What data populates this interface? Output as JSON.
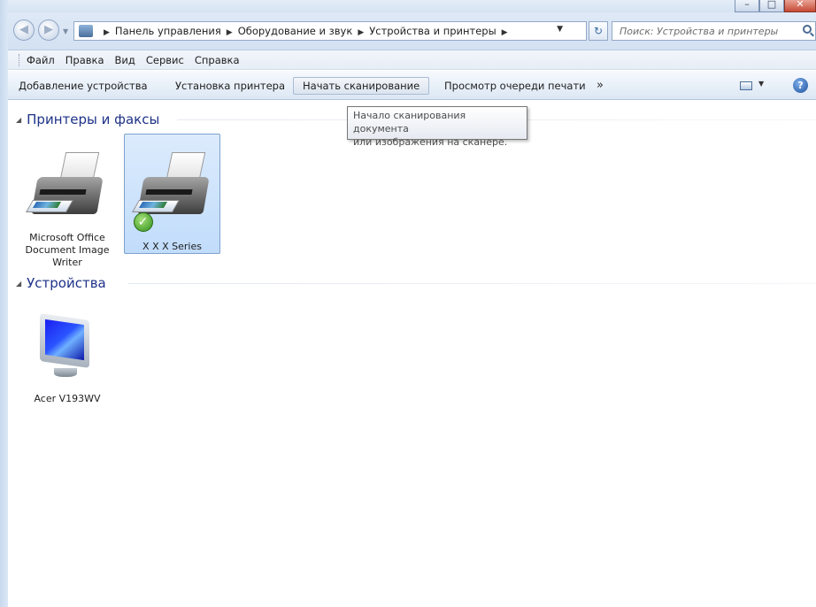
{
  "window": {
    "caption_buttons": [
      {
        "icon": "minimize-icon",
        "glyph": "–"
      },
      {
        "icon": "maximize-icon",
        "glyph": "□"
      },
      {
        "icon": "close-icon",
        "glyph": "✕"
      }
    ]
  },
  "address_bar": {
    "breadcrumbs": [
      "Панель управления",
      "Оборудование и звук",
      "Устройства и принтеры"
    ],
    "search_placeholder": "Поиск: Устройства и принтеры"
  },
  "menu": {
    "items": [
      "Файл",
      "Правка",
      "Вид",
      "Сервис",
      "Справка"
    ]
  },
  "commands": {
    "add_device": "Добавление устройства",
    "add_printer": "Установка принтера",
    "start_scan": "Начать сканирование",
    "print_queue": "Просмотр очереди печати",
    "more": "»",
    "help": "?"
  },
  "tooltip": {
    "line1": "Начало сканирования документа",
    "line2": "или изображения на сканере."
  },
  "groups": {
    "printers": {
      "title": "Принтеры и факсы",
      "items": [
        {
          "label_lines": [
            "Microsoft Office",
            "Document Image",
            "Writer"
          ],
          "icon": "printer-icon",
          "selected": false
        },
        {
          "label_lines": [
            "X X X  Series"
          ],
          "icon": "printer-icon",
          "selected": true,
          "default": true
        }
      ]
    },
    "devices": {
      "title": "Устройства",
      "items": [
        {
          "label_lines": [
            "Acer V193WV"
          ],
          "icon": "monitor-icon"
        }
      ]
    }
  },
  "colors": {
    "group_title": "#1e3287",
    "selection": "#c1dcfb",
    "chrome": "#dce7f4"
  }
}
